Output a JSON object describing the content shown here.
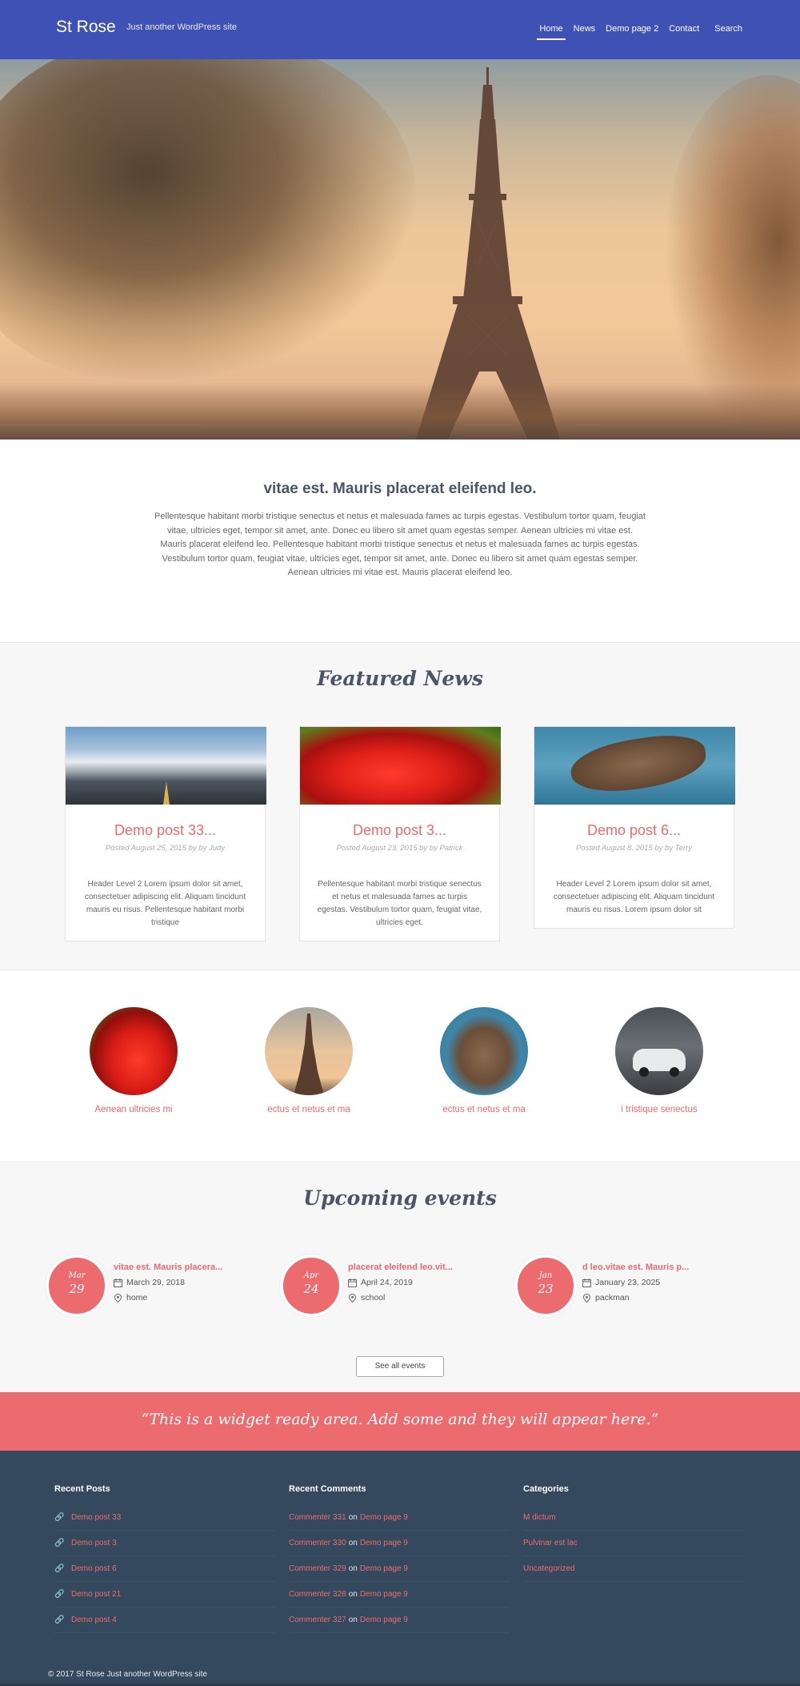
{
  "header": {
    "site_title": "St Rose",
    "tagline": "Just another WordPress site",
    "nav": [
      "Home",
      "News",
      "Demo page 2",
      "Contact"
    ],
    "search_label": "Search"
  },
  "intro": {
    "title": "vitae est. Mauris placerat eleifend leo.",
    "text": "Pellentesque habitant morbi tristique senectus et netus et malesuada fames ac turpis egestas. Vestibulum tortor quam, feugiat vitae, ultricies eget, tempor sit amet, ante. Donec eu libero sit amet quam egestas semper. Aenean ultricies mi vitae est. Mauris placerat eleifend leo. Pellentesque habitant morbi tristique senectus et netus et malesuada fames ac turpis egestas. Vestibulum tortor quam, feugiat vitae, ultricies eget, tempor sit amet, ante. Donec eu libero sit amet quam egestas semper. Aenean ultricies mi vitae est. Mauris placerat eleifend leo."
  },
  "featured": {
    "heading": "Featured News",
    "cards": [
      {
        "title": "Demo post 33...",
        "meta": "Posted August 25, 2015 by by Judy",
        "text": "Header Level 2 Lorem ipsum dolor sit amet, consectetuer adipiscing elit. Aliquam tincidunt mauris eu risus. Pellentesque habitant morbi tristique"
      },
      {
        "title": "Demo post 3...",
        "meta": "Posted August 23, 2015 by by Patrick",
        "text": "Pellentesque habitant morbi tristique senectus et netus et malesuada fames ac turpis egestas. Vestibulum tortor quam, feugiat vitae, ultricies eget."
      },
      {
        "title": "Demo post 6...",
        "meta": "Posted August 8, 2015 by by Terry",
        "text": "Header Level 2 Lorem ipsum dolor sit amet, consectetuer adipiscing elit. Aliquam tincidunt mauris eu risus. Lorem ipsum dolor sit"
      }
    ]
  },
  "circles": [
    {
      "label": "Aenean ultricies mi"
    },
    {
      "label": "ectus et netus et ma"
    },
    {
      "label": "ectus et netus et ma"
    },
    {
      "label": "i tristique senectus"
    }
  ],
  "events": {
    "heading": "Upcoming events",
    "items": [
      {
        "month": "Mar",
        "day": "29",
        "title": "vitae est. Mauris placera...",
        "date": "March 29, 2018",
        "location": "home"
      },
      {
        "month": "Apr",
        "day": "24",
        "title": "placerat eleifend leo.vit...",
        "date": "April 24, 2019",
        "location": "school"
      },
      {
        "month": "Jan",
        "day": "23",
        "title": "d leo.vitae est. Mauris p...",
        "date": "January 23, 2025",
        "location": "packman"
      }
    ],
    "see_all": "See all events"
  },
  "widget": {
    "text": "“This is a widget ready area. Add some and they will appear here.”"
  },
  "footer": {
    "recent_posts": {
      "heading": "Recent Posts",
      "items": [
        "Demo post 33",
        "Demo post 3",
        "Demo post 6",
        "Demo post 21",
        "Demo post 4"
      ]
    },
    "recent_comments": {
      "heading": "Recent Comments",
      "on_word": "on",
      "items": [
        {
          "author": "Commenter 331",
          "post": "Demo page 9"
        },
        {
          "author": "Commenter 330",
          "post": "Demo page 9"
        },
        {
          "author": "Commenter 329",
          "post": "Demo page 9"
        },
        {
          "author": "Commenter 328",
          "post": "Demo page 9"
        },
        {
          "author": "Commenter 327",
          "post": "Demo page 9"
        }
      ]
    },
    "categories": {
      "heading": "Categories",
      "items": [
        "M dictum",
        "Pulvinar est lac",
        "Uncategorized"
      ]
    },
    "copyright": "© 2017 St Rose Just another WordPress site"
  },
  "colors": {
    "header_bg": "#3f51b5",
    "accent": "#ec6b6f",
    "footer_bg": "#34495e"
  },
  "icons": {
    "calendar": "calendar-icon",
    "location": "map-pin-icon",
    "post_link": "link-icon"
  }
}
